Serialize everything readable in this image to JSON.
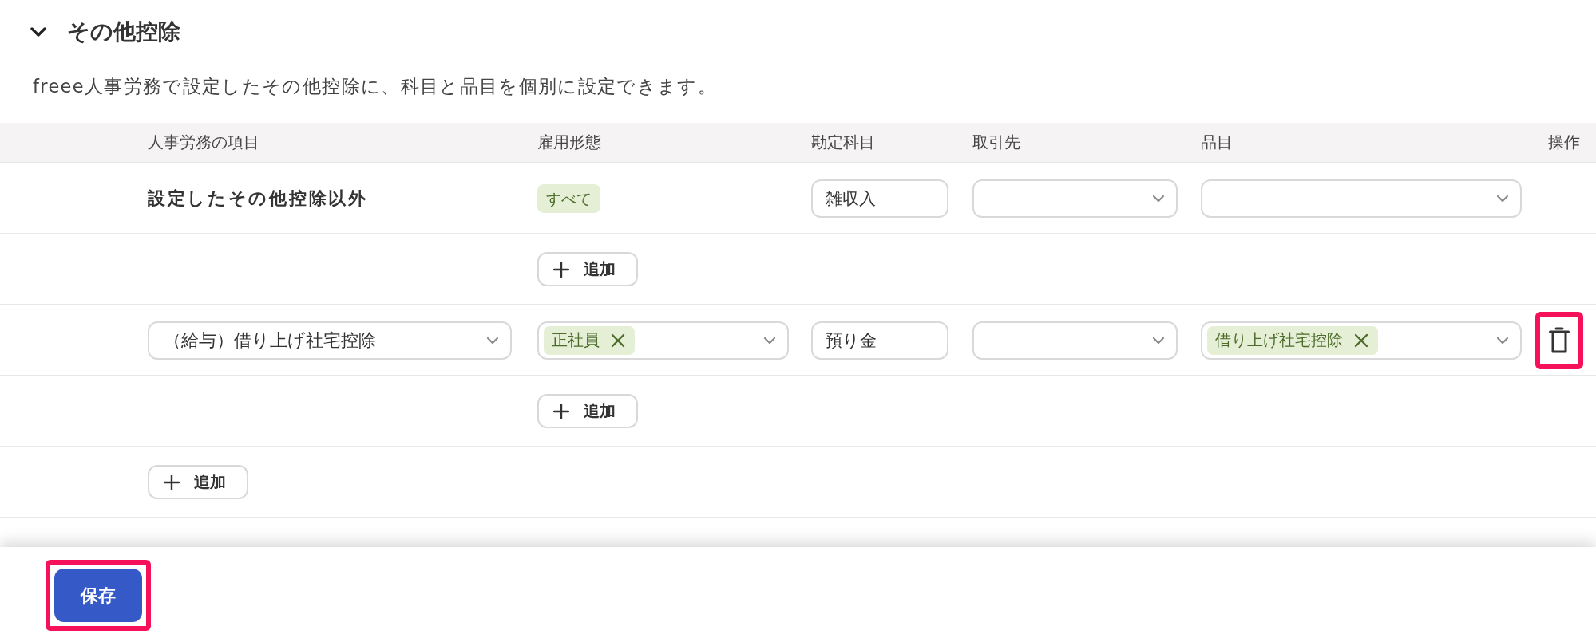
{
  "section": {
    "title": "その他控除",
    "expanded": true,
    "description": "freee人事労務で設定したその他控除に、科目と品目を個別に設定できます。"
  },
  "table": {
    "columns": [
      "人事労務の項目",
      "雇用形態",
      "勘定科目",
      "取引先",
      "品目",
      "操作"
    ],
    "rows": [
      {
        "kind": "fallback",
        "item": "設定したその他控除以外",
        "employment_types": [
          "すべて"
        ],
        "account": "雑収入"
      },
      {
        "kind": "add_employment",
        "add_employment_button": "追加"
      },
      {
        "kind": "mapping",
        "item": "（給与）借り上げ社宅控除",
        "employment_types": [
          "正社員"
        ],
        "account": "預り金",
        "goods": [
          "借り上げ社宅控除"
        ],
        "delete": {
          "highlighted": true
        }
      },
      {
        "kind": "add_employment",
        "add_employment_button": "追加"
      },
      {
        "kind": "add_item",
        "add_item_button": "追加"
      }
    ]
  },
  "save_button": {
    "label": "保存",
    "highlighted": true
  }
}
